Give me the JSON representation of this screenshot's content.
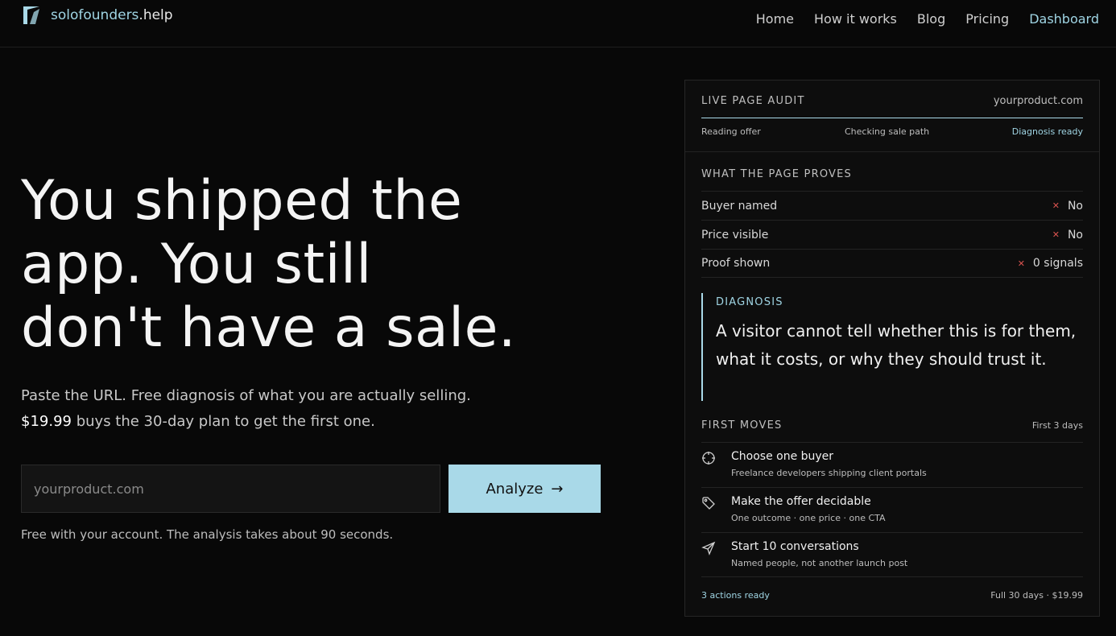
{
  "brand": {
    "name": "solofounders",
    "tld": ".help"
  },
  "nav": {
    "items": [
      "Home",
      "How it works",
      "Blog",
      "Pricing"
    ],
    "dashboard": "Dashboard"
  },
  "hero": {
    "title_lines": [
      "You shipped the",
      "app. You still",
      "don't have a sale."
    ],
    "sub_part1": "Paste the URL. Free diagnosis of what you are actually selling. ",
    "sub_price": "$19.99",
    "sub_part2": " buys the 30-day plan to get the first one.",
    "input_placeholder": "yourproduct.com",
    "analyze_label": "Analyze",
    "note": "Free with your account. The analysis takes about 90 seconds."
  },
  "audit": {
    "label": "LIVE PAGE AUDIT",
    "domain": "yourproduct.com",
    "steps": [
      "Reading offer",
      "Checking sale path",
      "Diagnosis ready"
    ],
    "proves_label": "WHAT THE PAGE PROVES",
    "proofs": [
      {
        "label": "Buyer named",
        "value": "No"
      },
      {
        "label": "Price visible",
        "value": "No"
      },
      {
        "label": "Proof shown",
        "value": "0 signals"
      }
    ],
    "diagnosis_label": "DIAGNOSIS",
    "diagnosis_text": "A visitor cannot tell whether this is for them, what it costs, or why they should trust it.",
    "moves_label": "FIRST MOVES",
    "moves_days": "First 3 days",
    "moves": [
      {
        "icon": "target-icon",
        "title": "Choose one buyer",
        "desc": "Freelance developers shipping client portals"
      },
      {
        "icon": "tag-icon",
        "title": "Make the offer decidable",
        "desc": "One outcome · one price · one CTA"
      },
      {
        "icon": "send-icon",
        "title": "Start 10 conversations",
        "desc": "Named people, not another launch post"
      }
    ],
    "foot_left": "3 actions ready",
    "foot_right": "Full 30 days · $19.99"
  },
  "colors": {
    "accent": "#a9d9e8",
    "background": "#080808",
    "negative": "#d9534f"
  }
}
